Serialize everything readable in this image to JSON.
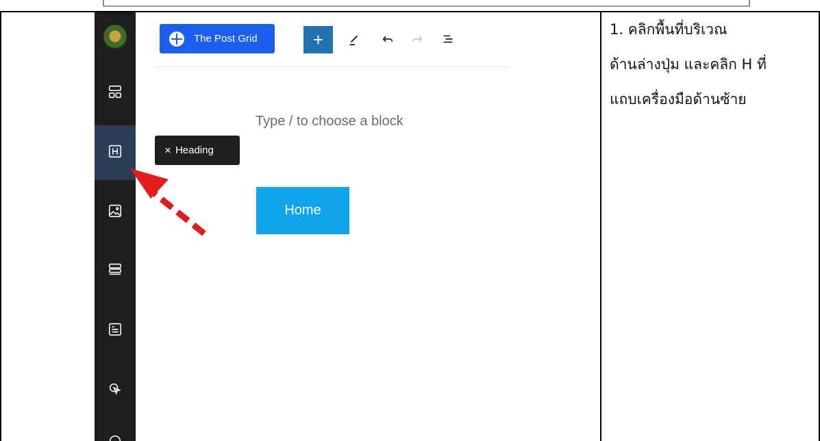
{
  "top_bar": {},
  "editor": {
    "block_plugin_label": "The Post Grid",
    "add_block_label": "+",
    "placeholder": "Type / to choose a block",
    "button_text": "Home"
  },
  "tooltip": {
    "close_glyph": "×",
    "label": "Heading"
  },
  "sidebar": {
    "items": [
      {
        "icon": "logo"
      },
      {
        "icon": "layout-grid-icon"
      },
      {
        "icon": "heading-icon",
        "active": true
      },
      {
        "icon": "image-icon"
      },
      {
        "icon": "stack-icon"
      },
      {
        "icon": "text-block-icon"
      },
      {
        "icon": "pointer-icon"
      }
    ]
  },
  "instruction": {
    "lines": [
      "1. คลิกพื้นที่บริเวณ",
      "ด้านล่างปุ่ม และคลิก H ที่",
      "แถบเครื่องมือด้านซ้าย"
    ]
  },
  "colors": {
    "rail": "#1e1e1e",
    "active": "#2c3e57",
    "post_grid": "#1a5ff0",
    "add_button": "#2271b1",
    "home_button": "#0ea5ec",
    "arrow": "#e31b1b"
  }
}
